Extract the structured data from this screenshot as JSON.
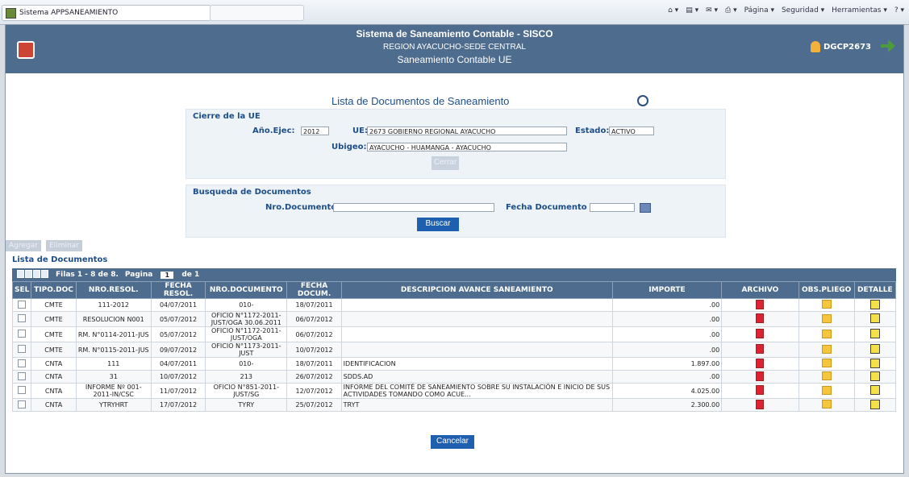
{
  "browser": {
    "tab_title": "Sistema APPSANEAMIENTO",
    "toolbar": [
      "Página ▾",
      "Seguridad ▾",
      "Herramientas ▾"
    ]
  },
  "header": {
    "title": "Sistema de Saneamiento Contable - SISCO",
    "subtitle": "REGION AYACUCHO-SEDE CENTRAL",
    "subtitle2": "Saneamiento Contable UE",
    "user": "DGCP2673"
  },
  "page_title": "Lista de Documentos de Saneamiento",
  "cierre": {
    "title": "Cierre de la UE",
    "anio_label": "Año.Ejec:",
    "anio_value": "2012",
    "ue_label": "UE:",
    "ue_value": "2673 GOBIERNO REGIONAL AYACUCHO",
    "estado_label": "Estado:",
    "estado_value": "ACTIVO",
    "ubigeo_label": "Ubigeo:",
    "ubigeo_value": "AYACUCHO - HUAMANGA - AYACUCHO",
    "cerrar_label": "Cerrar"
  },
  "busqueda": {
    "title": "Busqueda de Documentos",
    "nro_label": "Nro.Documento",
    "fecha_label": "Fecha Documento",
    "buscar_label": "Buscar"
  },
  "actions": {
    "agregar": "Agregar",
    "eliminar": "Eliminar"
  },
  "lista_title": "Lista de Documentos",
  "pager": {
    "filas": "Filas 1 - 8 de 8.",
    "pagina_label": "Pagina",
    "pagina_value": "1",
    "de": "de 1"
  },
  "columns": [
    "SEL",
    "TIPO.DOC",
    "NRO.RESOL.",
    "FECHA RESOL.",
    "NRO.DOCUMENTO",
    "FECHA DOCUM.",
    "DESCRIPCION AVANCE SANEAMIENTO",
    "IMPORTE",
    "ARCHIVO",
    "OBS.PLIEGO",
    "DETALLE"
  ],
  "rows": [
    {
      "tipo": "CMTE",
      "resol": "111-2012",
      "fresol": "04/07/2011",
      "doc": "010-",
      "fdoc": "18/07/2011",
      "desc": "",
      "importe": ".00"
    },
    {
      "tipo": "CMTE",
      "resol": "RESOLUCION N001",
      "fresol": "05/07/2012",
      "doc": "OFICIO N°1172-2011-JUST/OGA 30.06.2011",
      "fdoc": "06/07/2012",
      "desc": "",
      "importe": ".00"
    },
    {
      "tipo": "CMTE",
      "resol": "RM. N°0114-2011-JUS",
      "fresol": "05/07/2012",
      "doc": "OFICIO N°1172-2011-JUST/OGA",
      "fdoc": "06/07/2012",
      "desc": "",
      "importe": ".00"
    },
    {
      "tipo": "CMTE",
      "resol": "RM. N°0115-2011-JUS",
      "fresol": "09/07/2012",
      "doc": "OFICIO N°1173-2011-JUST",
      "fdoc": "10/07/2012",
      "desc": "",
      "importe": ".00"
    },
    {
      "tipo": "CNTA",
      "resol": "111",
      "fresol": "04/07/2011",
      "doc": "010-",
      "fdoc": "18/07/2011",
      "desc": "IDENTIFICACION",
      "importe": "1.897.00"
    },
    {
      "tipo": "CNTA",
      "resol": "31",
      "fresol": "10/07/2012",
      "doc": "213",
      "fdoc": "26/07/2012",
      "desc": "SDDS.AD",
      "importe": ".00"
    },
    {
      "tipo": "CNTA",
      "resol": "INFORME Nº 001-2011-IN/CSC",
      "fresol": "11/07/2012",
      "doc": "OFICIO N°851-2011-JUST/SG",
      "fdoc": "12/07/2012",
      "desc": "INFORME DEL COMITÉ DE SANEAMIENTO SOBRE SU INSTALACIÓN E INICIO DE SUS ACTIVIDADES TOMANDO COMO ACUE...",
      "importe": "4.025.00"
    },
    {
      "tipo": "CNTA",
      "resol": "YTRYHRT",
      "fresol": "17/07/2012",
      "doc": "TYRY",
      "fdoc": "25/07/2012",
      "desc": "TRYT",
      "importe": "2.300.00"
    }
  ],
  "cancelar_label": "Cancelar"
}
